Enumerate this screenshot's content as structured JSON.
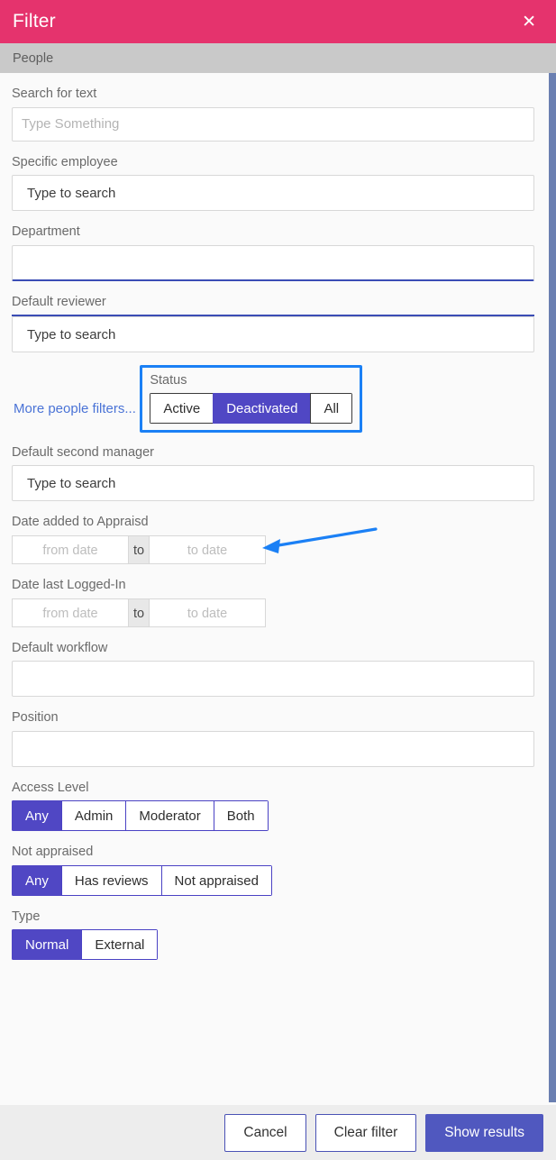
{
  "window": {
    "title": "Filter",
    "close_icon": "close-icon"
  },
  "tabs": [
    {
      "label": "People",
      "active": true
    }
  ],
  "form": {
    "search_text": {
      "label": "Search for text",
      "placeholder": "Type Something",
      "value": ""
    },
    "specific_employee": {
      "label": "Specific employee",
      "placeholder": "Type to search",
      "value": ""
    },
    "department": {
      "label": "Department",
      "placeholder": "",
      "value": ""
    },
    "default_reviewer": {
      "label": "Default reviewer",
      "placeholder": "Type to search",
      "value": ""
    },
    "more_filters_link": "More people filters...",
    "status": {
      "label": "Status",
      "options": [
        "Active",
        "Deactivated",
        "All"
      ],
      "selected": "Deactivated",
      "highlighted": true
    },
    "default_second_manager": {
      "label": "Default second manager",
      "placeholder": "Type to search",
      "value": ""
    },
    "date_added": {
      "label": "Date added to Appraisd",
      "from_placeholder": "from date",
      "separator": "to",
      "to_placeholder": "to date",
      "from_value": "",
      "to_value": ""
    },
    "date_last_login": {
      "label": "Date last Logged-In",
      "from_placeholder": "from date",
      "separator": "to",
      "to_placeholder": "to date",
      "from_value": "",
      "to_value": ""
    },
    "default_workflow": {
      "label": "Default workflow",
      "placeholder": "",
      "value": ""
    },
    "position": {
      "label": "Position",
      "placeholder": "",
      "value": ""
    },
    "access_level": {
      "label": "Access Level",
      "options": [
        "Any",
        "Admin",
        "Moderator",
        "Both"
      ],
      "selected": "Any"
    },
    "not_appraised": {
      "label": "Not appraised",
      "options": [
        "Any",
        "Has reviews",
        "Not appraised"
      ],
      "selected": "Any"
    },
    "type": {
      "label": "Type",
      "options": [
        "Normal",
        "External"
      ],
      "selected": "Normal"
    }
  },
  "footer": {
    "cancel": "Cancel",
    "clear_filter": "Clear filter",
    "show_results": "Show results"
  },
  "colors": {
    "header_pink": "#e5336d",
    "accent_purple": "#5047c4",
    "highlight_blue": "#1b80f5",
    "annotation_blue": "#1b80f5",
    "tab_gray": "#c9c9c9",
    "scrollbar": "#6a7fb1"
  }
}
